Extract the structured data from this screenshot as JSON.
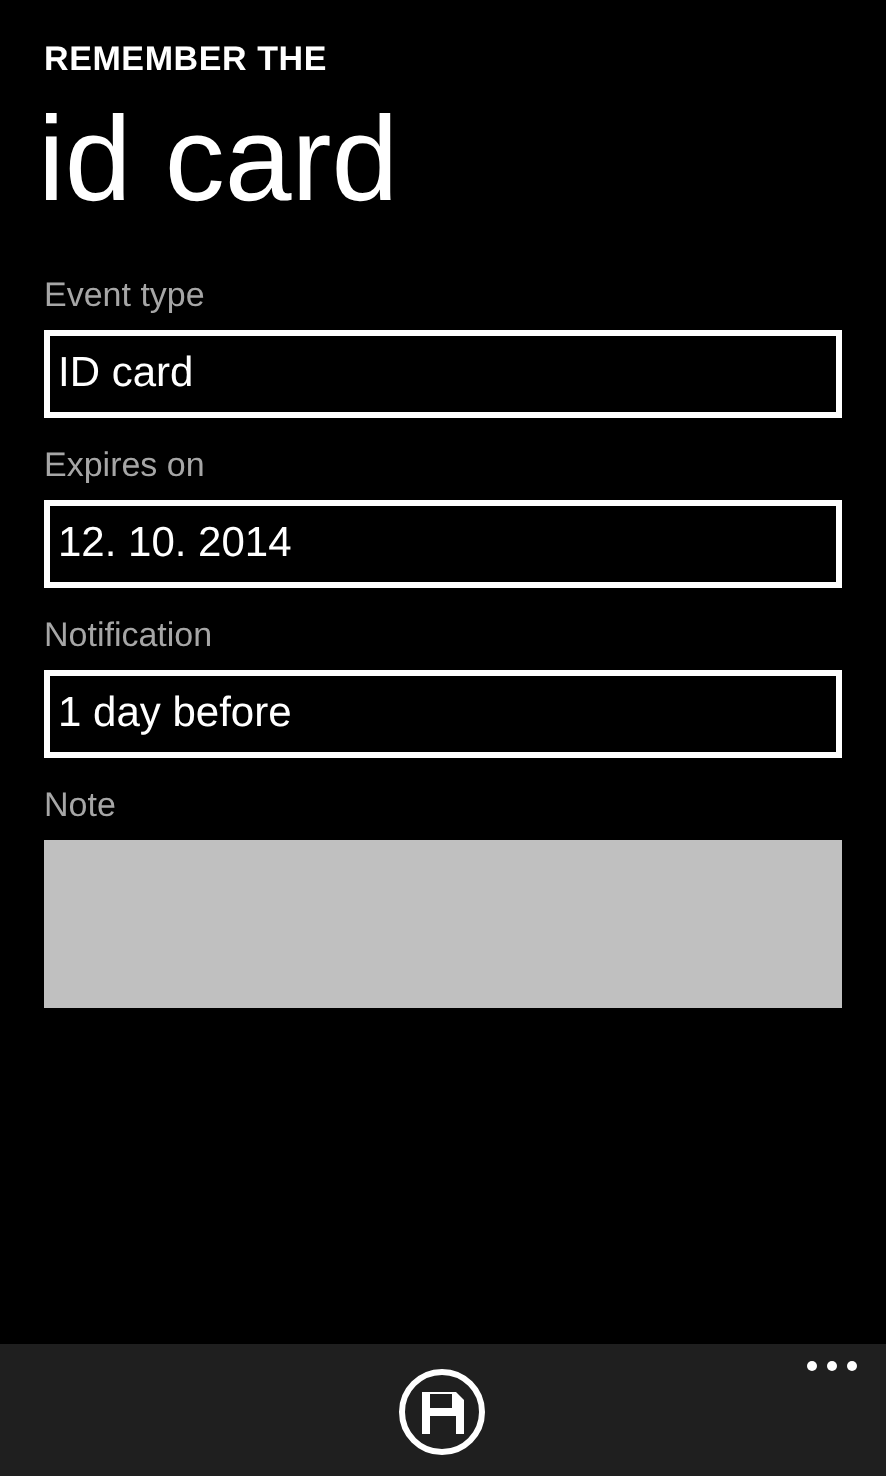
{
  "app_title": "REMEMBER THE",
  "page_title": "id card",
  "fields": [
    {
      "kind": "text",
      "label": "Event type",
      "value": "ID card"
    },
    {
      "kind": "text",
      "label": "Expires on",
      "value": "12. 10. 2014"
    },
    {
      "kind": "text",
      "label": "Notification",
      "value": "1 day before"
    },
    {
      "kind": "note",
      "label": "Note"
    }
  ]
}
